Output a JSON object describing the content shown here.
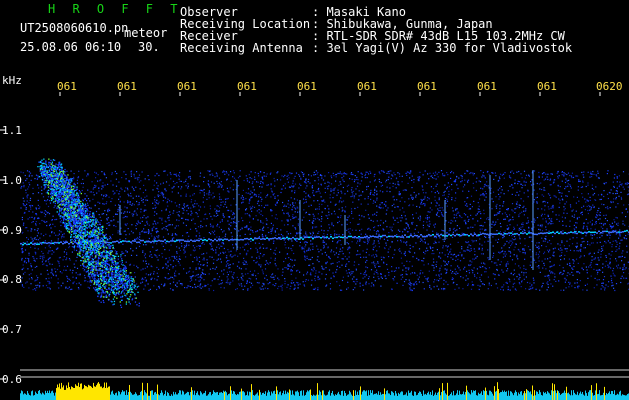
{
  "header": {
    "app_name": "H R O F F T",
    "filename": "UT2508060610.pn",
    "meteor_label": "meteor",
    "timestamp": "25.08.06 06:10",
    "frame_number": "30.",
    "info": [
      {
        "label": "Observer",
        "value": ": Masaki Kano"
      },
      {
        "label": "Receiving Location",
        "value": ": Shibukawa, Gunma, Japan"
      },
      {
        "label": "Receiver",
        "value": ": RTL-SDR SDR# 43dB L15 103.2MHz CW"
      },
      {
        "label": "Receiving Antenna",
        "value": ": 3el Yagi(V) Az 330 for Vladivostok"
      }
    ]
  },
  "axes": {
    "y_unit": "kHz",
    "y_ticks": [
      "1.1",
      "1.0",
      "0.9",
      "0.8",
      "0.7",
      "0.6"
    ],
    "x_ticks": [
      "061",
      "061",
      "061",
      "061",
      "061",
      "061",
      "061",
      "061",
      "061",
      "0620"
    ]
  },
  "colors": {
    "background": "#000000",
    "header_green": "#17d417",
    "tick_yellow": "#ffe04a",
    "signal_blue": "#1a3cff",
    "signal_cyan": "#00d0ff",
    "signal_green": "#7dff3a",
    "strip_cyan": "#12c8f0",
    "strip_yellow": "#ffe600"
  }
}
